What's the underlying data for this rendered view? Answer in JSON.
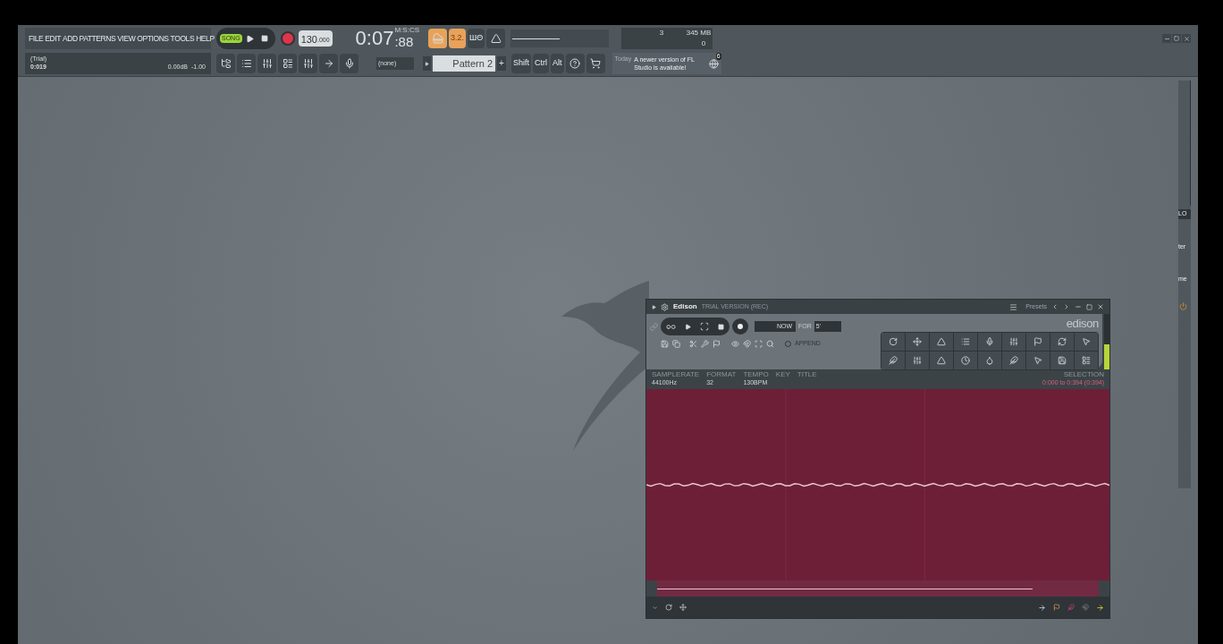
{
  "menu": [
    "FILE",
    "EDIT",
    "ADD",
    "PATTERNS",
    "VIEW",
    "OPTIONS",
    "TOOLS",
    "HELP"
  ],
  "transport": {
    "song_mode": true,
    "song_label": "SONG",
    "recording_armed": true,
    "tempo": "130",
    "tempo_fraction": ".000",
    "time": "0:07",
    "time_cs": ":88",
    "time_unit": "M:S:CS"
  },
  "master_volume": {
    "level": 0.5
  },
  "hint_bar": {
    "title": "(Trial)",
    "value": "0:019",
    "volume": "0.00dB",
    "pitch": "-1.00"
  },
  "snap": "(none)",
  "pattern": "Pattern 2",
  "pattern_add": "+",
  "modifiers": [
    "Shift",
    "Ctrl",
    "Alt"
  ],
  "toggles": [
    {
      "label": "3.2.",
      "on": true
    },
    {
      "label": "ШΘ",
      "on": false
    }
  ],
  "monitor": {
    "cpu": "3",
    "memory": "345 MB",
    "polyphony": "0"
  },
  "news": {
    "date": "Today",
    "text": "A newer version of FL Studio is available!",
    "badge": "6"
  },
  "mixer_strip": [
    "LO",
    "ter",
    "me"
  ],
  "edison": {
    "title": "Edison",
    "subtitle": "TRIAL VERSION (REC)",
    "presets": "Presets",
    "logo": "edison",
    "trigger": "NOW",
    "for_label": "FOR",
    "duration": "5'",
    "append": "APPEND",
    "append_checked": false,
    "info": [
      {
        "label": "SAMPLERATE",
        "value": "44100Hz"
      },
      {
        "label": "FORMAT",
        "value": "32"
      },
      {
        "label": "TEMPO",
        "value": "130BPM"
      },
      {
        "label": "KEY"
      },
      {
        "label": "TITLE"
      }
    ],
    "selection_label": "SELECTION",
    "selection": "0:000 to 0:394 (0:394)",
    "level": 0.45
  }
}
